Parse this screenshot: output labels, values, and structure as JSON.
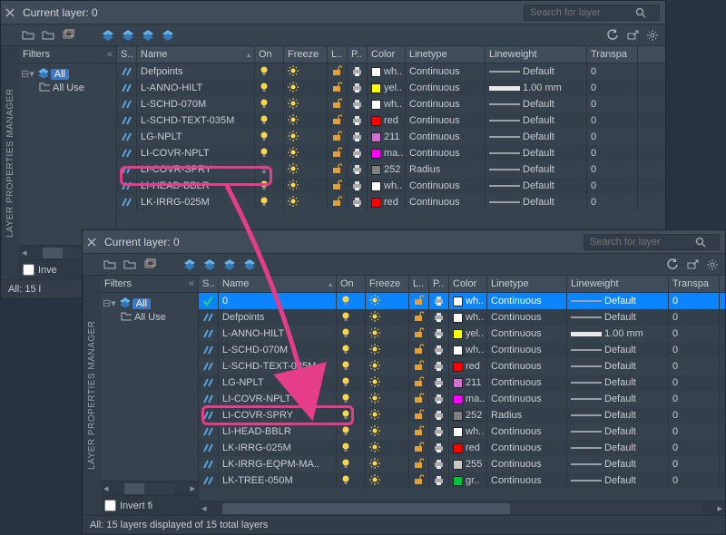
{
  "vertical_title": "LAYER PROPERTIES MANAGER",
  "header": {
    "title": "Current layer: 0",
    "search_placeholder": "Search for layer"
  },
  "filters": {
    "label": "Filters",
    "all": "All",
    "all_used": "All Use",
    "all_used_full": "All Used Layers",
    "invert_short": "Inve",
    "invert_full": "Invert fi"
  },
  "columns": {
    "status": "S..",
    "name": "Name",
    "on": "On",
    "freeze": "Freeze",
    "lock": "L..",
    "plot": "P..",
    "color": "Color",
    "linetype": "Linetype",
    "lineweight": "Lineweight",
    "transparency": "Transpa"
  },
  "status_back": "All: 15 l",
  "status_front": "All: 15 layers displayed of 15 total layers",
  "layers_back": [
    {
      "name": "Defpoints",
      "on": true,
      "col": "#ffffff",
      "cname": "wh..",
      "ltype": "Continuous",
      "lw": "Default",
      "lwthick": false,
      "tr": "0"
    },
    {
      "name": "L-ANNO-HILT",
      "on": true,
      "col": "#ffff00",
      "cname": "yel..",
      "ltype": "Continuous",
      "lw": "1.00 mm",
      "lwthick": true,
      "tr": "0"
    },
    {
      "name": "L-SCHD-070M",
      "on": true,
      "col": "#ffffff",
      "cname": "wh..",
      "ltype": "Continuous",
      "lw": "Default",
      "lwthick": false,
      "tr": "0"
    },
    {
      "name": "L-SCHD-TEXT-035M",
      "on": true,
      "col": "#ff0000",
      "cname": "red",
      "ltype": "Continuous",
      "lw": "Default",
      "lwthick": false,
      "tr": "0"
    },
    {
      "name": "LG-NPLT",
      "on": true,
      "col": "#d070d0",
      "cname": "211",
      "ltype": "Continuous",
      "lw": "Default",
      "lwthick": false,
      "tr": "0"
    },
    {
      "name": "LI-COVR-NPLT",
      "on": true,
      "col": "#ff00ff",
      "cname": "ma..",
      "ltype": "Continuous",
      "lw": "Default",
      "lwthick": false,
      "tr": "0"
    },
    {
      "name": "LI-COVR-SPRY",
      "on": false,
      "col": "#808080",
      "cname": "252",
      "ltype": "Radius",
      "lw": "Default",
      "lwthick": false,
      "tr": "0"
    },
    {
      "name": "LI-HEAD-BBLR",
      "on": true,
      "col": "#ffffff",
      "cname": "wh..",
      "ltype": "Continuous",
      "lw": "Default",
      "lwthick": false,
      "tr": "0"
    },
    {
      "name": "LK-IRRG-025M",
      "on": true,
      "col": "#ff0000",
      "cname": "red",
      "ltype": "Continuous",
      "lw": "Default",
      "lwthick": false,
      "tr": "0"
    }
  ],
  "layers_front": [
    {
      "name": "0",
      "on": true,
      "col": "#ffffff",
      "cname": "wh..",
      "ltype": "Continuous",
      "lw": "Default",
      "lwthick": false,
      "tr": "0",
      "sel": true,
      "check": true
    },
    {
      "name": "Defpoints",
      "on": true,
      "col": "#ffffff",
      "cname": "wh..",
      "ltype": "Continuous",
      "lw": "Default",
      "lwthick": false,
      "tr": "0"
    },
    {
      "name": "L-ANNO-HILT",
      "on": true,
      "col": "#ffff00",
      "cname": "yel..",
      "ltype": "Continuous",
      "lw": "1.00 mm",
      "lwthick": true,
      "tr": "0"
    },
    {
      "name": "L-SCHD-070M",
      "on": true,
      "col": "#ffffff",
      "cname": "wh..",
      "ltype": "Continuous",
      "lw": "Default",
      "lwthick": false,
      "tr": "0"
    },
    {
      "name": "L-SCHD-TEXT-035M",
      "on": true,
      "col": "#ff0000",
      "cname": "red",
      "ltype": "Continuous",
      "lw": "Default",
      "lwthick": false,
      "tr": "0"
    },
    {
      "name": "LG-NPLT",
      "on": true,
      "col": "#d070d0",
      "cname": "211",
      "ltype": "Continuous",
      "lw": "Default",
      "lwthick": false,
      "tr": "0"
    },
    {
      "name": "LI-COVR-NPLT",
      "on": true,
      "col": "#ff00ff",
      "cname": "ma..",
      "ltype": "Continuous",
      "lw": "Default",
      "lwthick": false,
      "tr": "0"
    },
    {
      "name": "LI-COVR-SPRY",
      "on": true,
      "col": "#808080",
      "cname": "252",
      "ltype": "Radius",
      "lw": "Default",
      "lwthick": false,
      "tr": "0"
    },
    {
      "name": "LI-HEAD-BBLR",
      "on": true,
      "col": "#ffffff",
      "cname": "wh..",
      "ltype": "Continuous",
      "lw": "Default",
      "lwthick": false,
      "tr": "0"
    },
    {
      "name": "LK-IRRG-025M",
      "on": true,
      "col": "#ff0000",
      "cname": "red",
      "ltype": "Continuous",
      "lw": "Default",
      "lwthick": false,
      "tr": "0"
    },
    {
      "name": "LK-IRRG-EQPM-MA..",
      "on": true,
      "col": "#c8c8c8",
      "cname": "255",
      "ltype": "Continuous",
      "lw": "Default",
      "lwthick": false,
      "tr": "0"
    },
    {
      "name": "LK-TREE-050M",
      "on": true,
      "col": "#00c040",
      "cname": "gr..",
      "ltype": "Continuous",
      "lw": "Default",
      "lwthick": false,
      "tr": "0"
    }
  ]
}
